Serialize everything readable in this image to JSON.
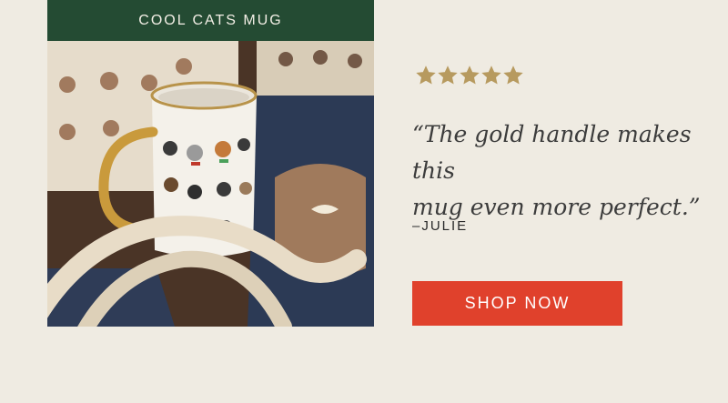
{
  "product": {
    "title": "COOL CATS MUG",
    "image_alt": "Cool cats mug with gold handle"
  },
  "review": {
    "rating": 5,
    "rating_max": 5,
    "star_color": "#b79a5f",
    "quote_line1": "“The gold handle makes this",
    "quote_line2": "mug even more perfect.”",
    "author": "–JULIE"
  },
  "cta": {
    "label": "SHOP NOW",
    "color": "#e0412c"
  },
  "colors": {
    "background": "#efebe2",
    "header": "#244b33"
  }
}
